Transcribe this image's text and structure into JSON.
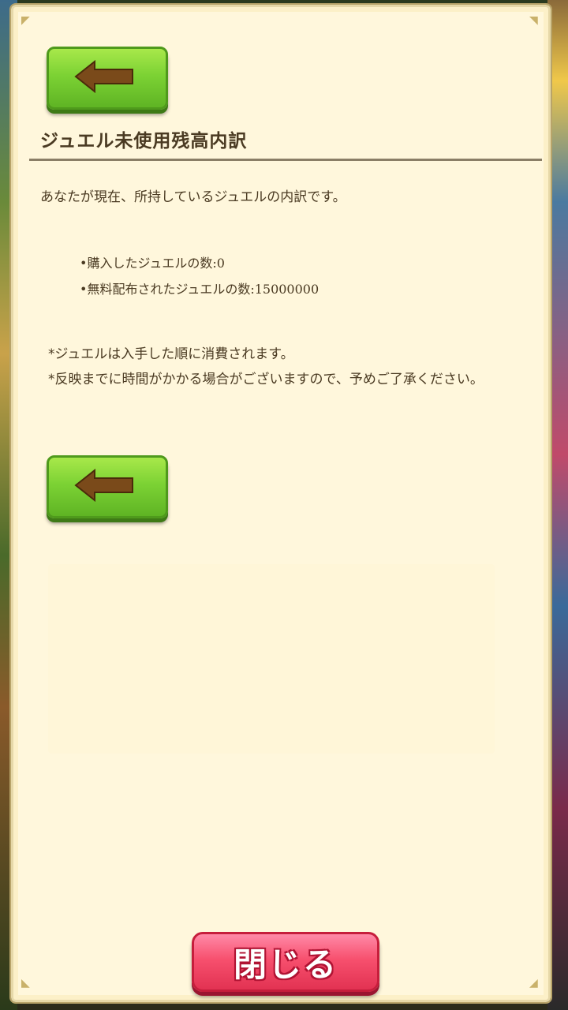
{
  "dialog": {
    "title": "ジュエル未使用残高内訳",
    "intro": "あなたが現在、所持しているジュエルの内訳です。",
    "bullets": [
      "•購入したジュエルの数:0",
      "•無料配布されたジュエルの数:15000000"
    ],
    "notes": [
      "*ジュエルは入手した順に消費されます。",
      "*反映までに時間がかかる場合がございますので、予めご了承ください。"
    ],
    "close_label": "閉じる"
  },
  "icons": {
    "back_top": "left-arrow-icon",
    "back_mid": "left-arrow-icon"
  },
  "colors": {
    "panel_bg": "#fff7dc",
    "text": "#4a3a22",
    "back_button": "#7cd234",
    "arrow": "#7a4a1a",
    "close_button": "#f7506e"
  }
}
